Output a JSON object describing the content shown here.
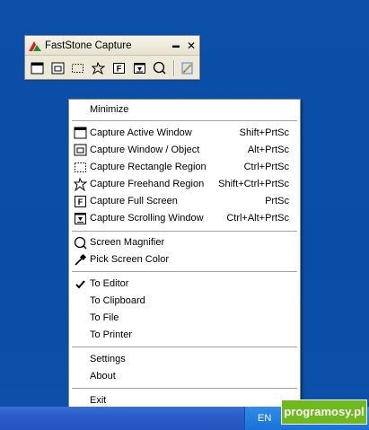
{
  "toolbar_window": {
    "title": "FastStone Capture",
    "minimize_glyph": "▬",
    "close_glyph": "✕",
    "tools": [
      {
        "icon": "active-window-icon"
      },
      {
        "icon": "window-object-icon"
      },
      {
        "icon": "rectangle-region-icon"
      },
      {
        "icon": "freehand-region-icon"
      },
      {
        "icon": "full-screen-icon"
      },
      {
        "icon": "scrolling-window-icon"
      },
      {
        "icon": "magnifier-icon"
      },
      {
        "icon": "output-settings-icon"
      }
    ]
  },
  "menu": {
    "minimize": "Minimize",
    "capture": [
      {
        "label": "Capture Active Window",
        "shortcut": "Shift+PrtSc"
      },
      {
        "label": "Capture Window / Object",
        "shortcut": "Alt+PrtSc"
      },
      {
        "label": "Capture Rectangle Region",
        "shortcut": "Ctrl+PrtSc"
      },
      {
        "label": "Capture Freehand Region",
        "shortcut": "Shift+Ctrl+PrtSc"
      },
      {
        "label": "Capture Full Screen",
        "shortcut": "PrtSc"
      },
      {
        "label": "Capture Scrolling Window",
        "shortcut": "Ctrl+Alt+PrtSc"
      }
    ],
    "tools": [
      {
        "label": "Screen Magnifier"
      },
      {
        "label": "Pick Screen Color"
      }
    ],
    "output": [
      {
        "label": "To Editor",
        "checked": true
      },
      {
        "label": "To Clipboard",
        "checked": false
      },
      {
        "label": "To File",
        "checked": false
      },
      {
        "label": "To Printer",
        "checked": false
      }
    ],
    "settings": "Settings",
    "about": "About",
    "exit": "Exit"
  },
  "taskbar": {
    "language": "EN"
  },
  "watermark": "programosy.pl",
  "colors": {
    "desktop": "#0a4ea8",
    "menu_bg": "#ffffff",
    "badge": "#6fb91e"
  }
}
